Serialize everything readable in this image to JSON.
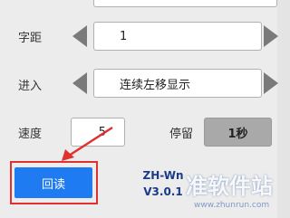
{
  "rows": {
    "spacing": {
      "label": "字距",
      "value": "1"
    },
    "enter": {
      "label": "进入",
      "value": "连续左移显示"
    },
    "speed": {
      "label": "速度",
      "value": "5"
    },
    "stay": {
      "label": "停留",
      "value": "1秒"
    }
  },
  "buttons": {
    "readback": "回读"
  },
  "model": {
    "line1": "ZH-Wn",
    "line2": "V3.0.1"
  },
  "watermark": {
    "text": "准软件站",
    "url": "www.zhunrun.com"
  },
  "colors": {
    "accent": "#1f7bf2",
    "highlight": "#e03030",
    "arrow": "#7a7a7a"
  }
}
